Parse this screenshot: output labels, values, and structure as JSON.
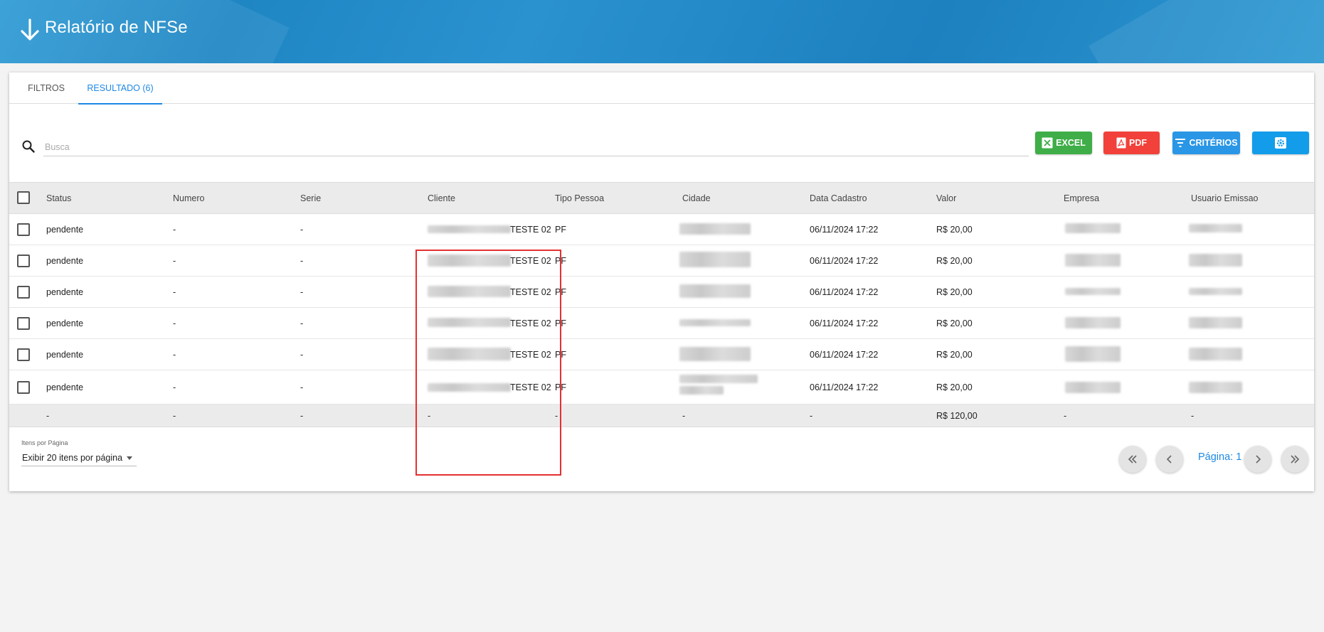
{
  "header": {
    "title": "Relatório de NFSe"
  },
  "tabs": [
    {
      "label": "FILTROS",
      "active": false
    },
    {
      "label": "RESULTADO (6)",
      "active": true
    }
  ],
  "search": {
    "placeholder": "Busca",
    "value": ""
  },
  "toolbar": {
    "excel_label": "EXCEL",
    "pdf_label": "PDF",
    "criteria_label": "CRITÉRIOS"
  },
  "table": {
    "headers": [
      "Status",
      "Numero",
      "Serie",
      "Cliente",
      "Tipo Pessoa",
      "Cidade",
      "Data Cadastro",
      "Valor",
      "Empresa",
      "Usuario Emissao"
    ],
    "rows": [
      {
        "status": "pendente",
        "numero": "-",
        "serie": "-",
        "cliente": "TESTE 02",
        "tipo": "PF",
        "data": "06/11/2024 17:22",
        "valor": "R$ 20,00"
      },
      {
        "status": "pendente",
        "numero": "-",
        "serie": "-",
        "cliente": "TESTE 02",
        "tipo": "PF",
        "data": "06/11/2024 17:22",
        "valor": "R$ 20,00"
      },
      {
        "status": "pendente",
        "numero": "-",
        "serie": "-",
        "cliente": "TESTE 02",
        "tipo": "PF",
        "data": "06/11/2024 17:22",
        "valor": "R$ 20,00"
      },
      {
        "status": "pendente",
        "numero": "-",
        "serie": "-",
        "cliente": "TESTE 02",
        "tipo": "PF",
        "data": "06/11/2024 17:22",
        "valor": "R$ 20,00"
      },
      {
        "status": "pendente",
        "numero": "-",
        "serie": "-",
        "cliente": "TESTE 02",
        "tipo": "PF",
        "data": "06/11/2024 17:22",
        "valor": "R$ 20,00"
      },
      {
        "status": "pendente",
        "numero": "-",
        "serie": "-",
        "cliente": "TESTE 02",
        "tipo": "PF",
        "data": "06/11/2024 17:22",
        "valor": "R$ 20,00"
      }
    ],
    "totals": {
      "status": "-",
      "numero": "-",
      "serie": "-",
      "cliente": "-",
      "tipo": "-",
      "cidade": "-",
      "data": "-",
      "valor": "R$ 120,00",
      "empresa": "-",
      "usuario": "-"
    }
  },
  "pagination": {
    "per_page_label": "Itens por Página",
    "per_page_value": "Exibir 20 itens por página",
    "page_label": "Página: 1"
  },
  "colors": {
    "header_bg": "#1f86c4",
    "accent": "#1e88e5",
    "excel": "#3fae48",
    "pdf": "#f1413a",
    "criteria": "#2a96e6",
    "settings": "#139ce9",
    "highlight": "#e53030"
  },
  "icons": {
    "back": "arrow-down-icon",
    "search": "search-icon",
    "excel": "excel-icon",
    "pdf": "pdf-icon",
    "criteria": "filter-icon",
    "settings": "gear-icon",
    "first": "double-chevron-left-icon",
    "prev": "chevron-left-icon",
    "next": "chevron-right-icon",
    "last": "double-chevron-right-icon"
  }
}
